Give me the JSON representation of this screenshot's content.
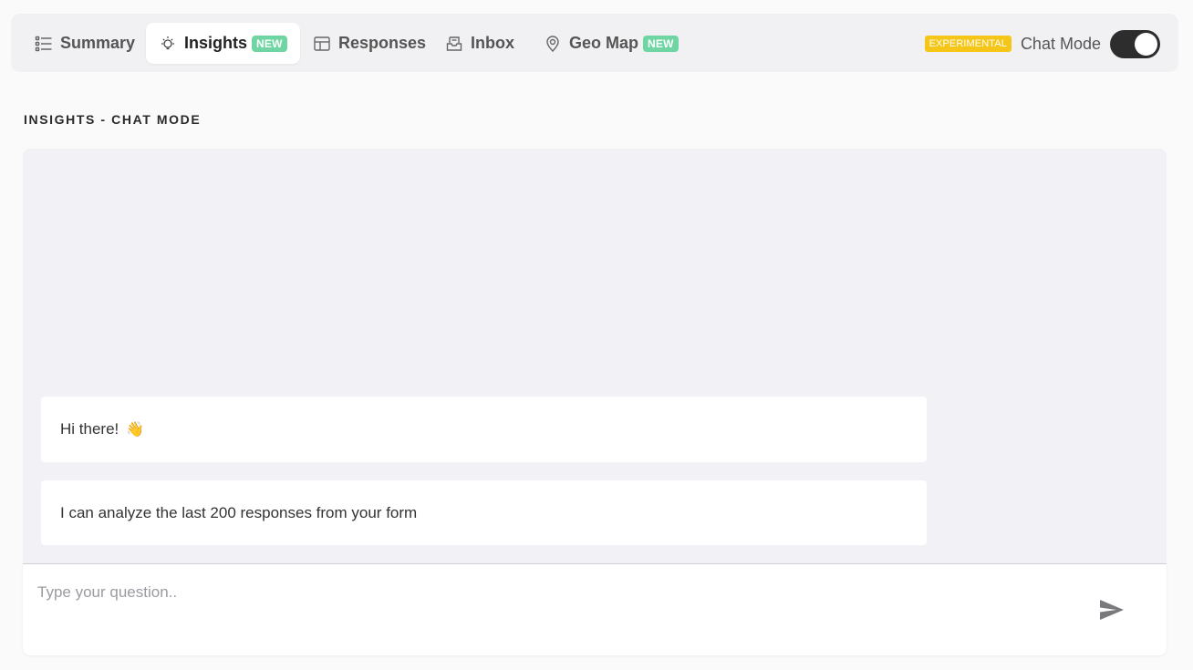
{
  "tabs": [
    {
      "label": "Summary",
      "icon": "list-icon",
      "active": false
    },
    {
      "label": "Insights",
      "icon": "bulb-icon",
      "active": true,
      "badge": "NEW"
    },
    {
      "label": "Responses",
      "icon": "table-icon",
      "active": false
    },
    {
      "label": "Inbox",
      "icon": "inbox-icon",
      "active": false
    },
    {
      "label": "Geo Map",
      "icon": "map-pin-icon",
      "active": false,
      "badge": "NEW"
    }
  ],
  "controls": {
    "experimental_badge": "EXPERIMENTAL",
    "chat_mode_label": "Chat Mode",
    "chat_mode_enabled": true
  },
  "section_title": "INSIGHTS - CHAT MODE",
  "messages": [
    {
      "text": "Hi there!",
      "emoji": "👋"
    },
    {
      "text": "I can analyze the last 200 responses from your form"
    }
  ],
  "input": {
    "placeholder": "Type your question..",
    "value": ""
  },
  "colors": {
    "badge_new": "#6fd6a3",
    "badge_experimental": "#f5c518",
    "toggle_on": "#2d2d2d",
    "chat_background": "#f2f2f6"
  }
}
